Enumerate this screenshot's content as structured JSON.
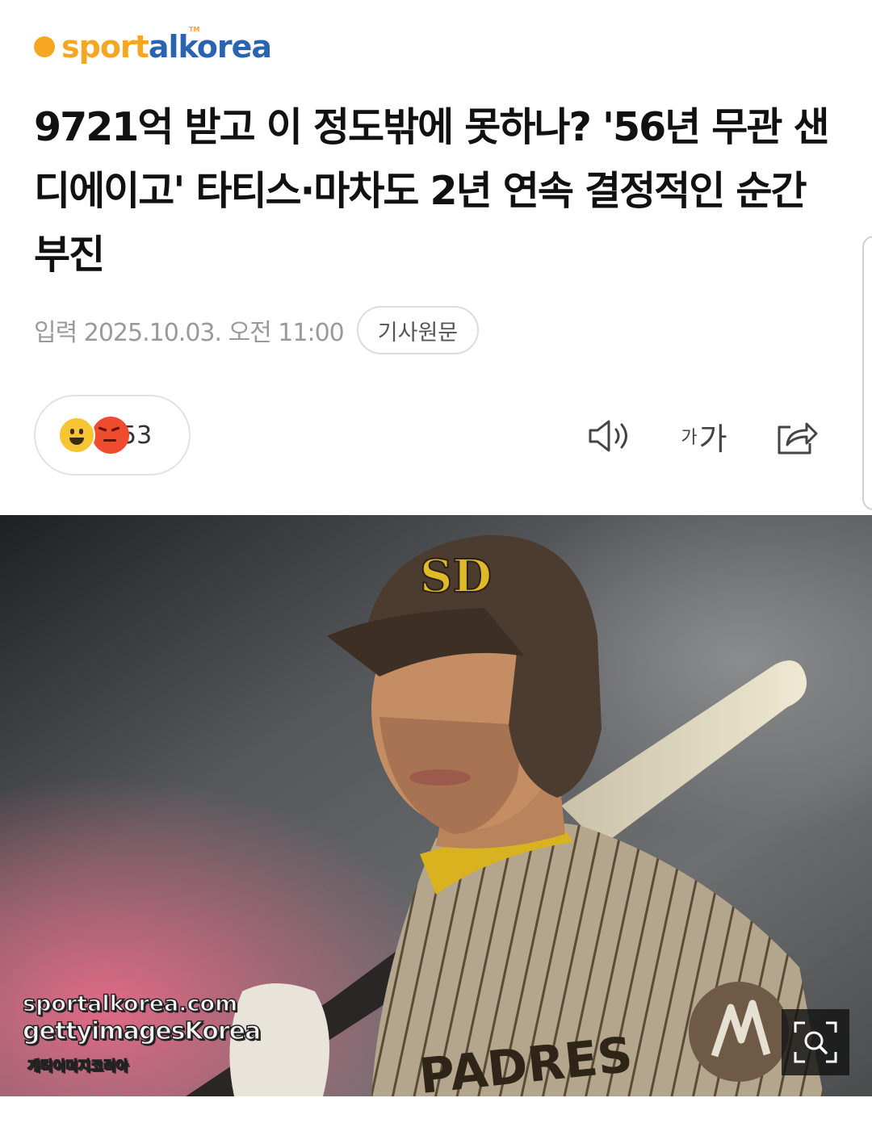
{
  "brand": {
    "logo_text_a": "sport",
    "logo_text_b": "alkorea",
    "tm": "TM"
  },
  "article": {
    "headline": "9721억 받고 이 정도밖에 못하나? '56년 무관 샌디에이고' 타티스·마차도 2년 연속 결정적인 순간 부진",
    "date": "입력 2025.10.03. 오전 11:00",
    "source_button": "기사원문"
  },
  "reactions": {
    "count": "53",
    "icons": [
      "happy-emoji-icon",
      "angry-emoji-icon"
    ]
  },
  "tools": {
    "sound": "speaker-icon",
    "font_small": "가",
    "font_large": "가",
    "share": "share-icon"
  },
  "photo": {
    "watermark_line1": "sportalkorea.com",
    "watermark_line2": "gettyimagesKorea",
    "watermark_line3": "게티이미지코리아",
    "helmet_logo": "SD",
    "jersey_text": "PADRES",
    "zoom": "zoom-icon"
  },
  "colors": {
    "brand_orange": "#f5a623",
    "brand_blue": "#2a63b0",
    "date_gray": "#9a9a9a"
  }
}
